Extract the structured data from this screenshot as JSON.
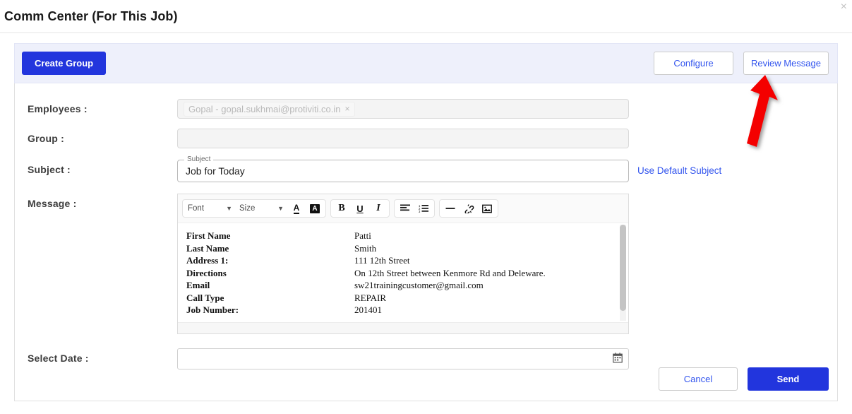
{
  "header": {
    "title": "Comm Center (For This Job)",
    "close_icon": "close-icon"
  },
  "action_bar": {
    "create_group_label": "Create Group",
    "configure_label": "Configure",
    "review_message_label": "Review Message"
  },
  "form": {
    "employees": {
      "label": "Employees :",
      "chip_text": "Gopal - gopal.sukhmai@protiviti.co.in",
      "chip_remove": "×"
    },
    "group": {
      "label": "Group :",
      "value": "",
      "placeholder": ""
    },
    "subject": {
      "label": "Subject :",
      "field_label": "Subject",
      "value": "Job for Today",
      "use_default_link": "Use Default Subject"
    },
    "message": {
      "label": "Message :",
      "toolbar": {
        "font_label": "Font",
        "size_label": "Size",
        "font_color_icon": "A",
        "background_color_icon": "A",
        "bold_icon": "B",
        "underline_icon": "U",
        "italic_icon": "I"
      },
      "body_rows": [
        {
          "key": "First Name",
          "value": "Patti"
        },
        {
          "key": "Last Name",
          "value": "Smith"
        },
        {
          "key": "Address 1:",
          "value": "111 12th Street"
        },
        {
          "key": "Directions",
          "value": "On 12th Street between Kenmore Rd and Deleware."
        },
        {
          "key": "Email",
          "value": "sw21trainingcustomer@gmail.com"
        },
        {
          "key": "Call Type",
          "value": "REPAIR"
        },
        {
          "key": "Job Number:",
          "value": "201401"
        }
      ]
    },
    "select_date": {
      "label": "Select Date :",
      "value": "",
      "calendar_icon": "calendar-icon"
    }
  },
  "footer": {
    "cancel_label": "Cancel",
    "send_label": "Send"
  },
  "annotation": {
    "arrow_color": "#f40000",
    "points_to": "Review Message"
  },
  "colors": {
    "primary": "#2235dd",
    "link": "#3355ee",
    "action_bar_bg": "#eef0fb"
  }
}
